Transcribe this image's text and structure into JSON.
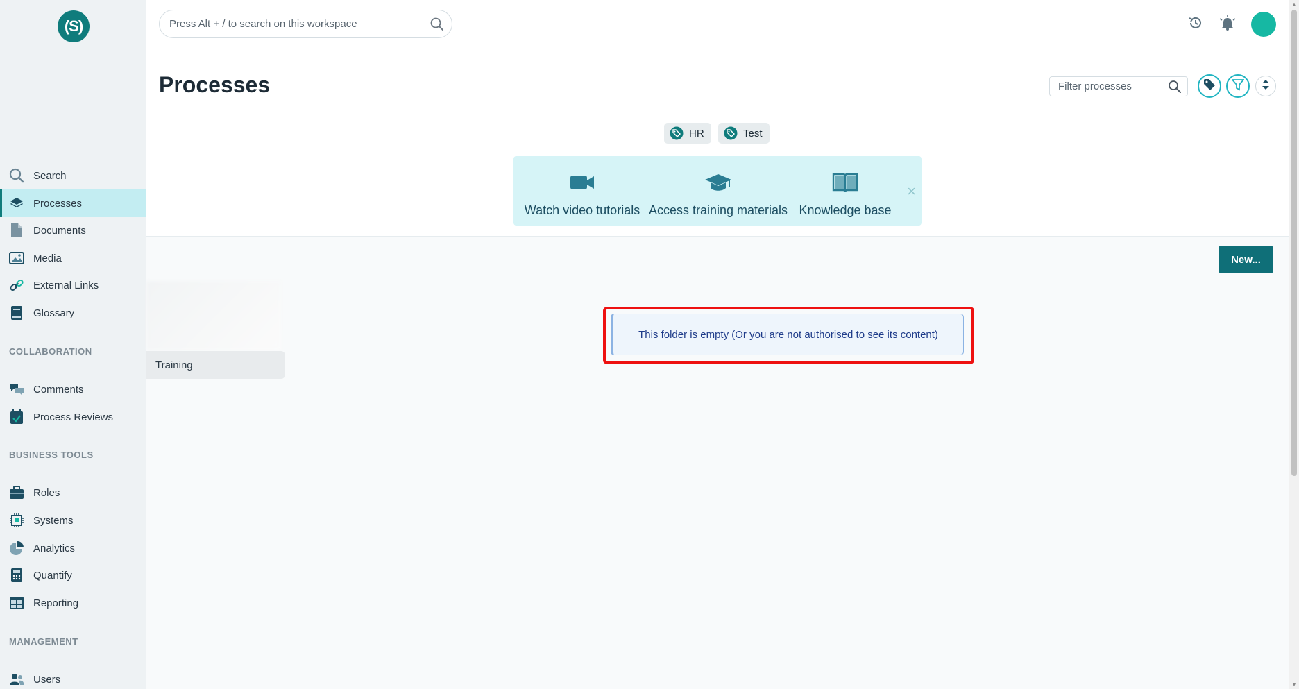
{
  "app": {
    "logo_text": "(S)"
  },
  "search": {
    "placeholder": "Press Alt + / to search on this workspace"
  },
  "sidebar": {
    "items": [
      {
        "label": "Search",
        "icon": "search-icon"
      },
      {
        "label": "Processes",
        "icon": "layers-icon",
        "active": true
      },
      {
        "label": "Documents",
        "icon": "document-icon"
      },
      {
        "label": "Media",
        "icon": "image-icon"
      },
      {
        "label": "External Links",
        "icon": "link-icon"
      },
      {
        "label": "Glossary",
        "icon": "book-icon"
      }
    ],
    "sections": {
      "collaboration": "COLLABORATION",
      "business_tools": "BUSINESS TOOLS",
      "management": "MANAGEMENT"
    },
    "collab_items": [
      {
        "label": "Comments",
        "icon": "comments-icon"
      },
      {
        "label": "Process Reviews",
        "icon": "calendar-check-icon"
      }
    ],
    "tools_items": [
      {
        "label": "Roles",
        "icon": "briefcase-icon"
      },
      {
        "label": "Systems",
        "icon": "chip-icon"
      },
      {
        "label": "Analytics",
        "icon": "pie-chart-icon"
      },
      {
        "label": "Quantify",
        "icon": "calculator-icon"
      },
      {
        "label": "Reporting",
        "icon": "table-icon"
      }
    ],
    "mgmt_items": [
      {
        "label": "Users",
        "icon": "users-icon"
      }
    ]
  },
  "header": {
    "title": "Processes",
    "filter_placeholder": "Filter processes"
  },
  "tags": [
    "HR",
    "Test"
  ],
  "help_panel": {
    "items": [
      {
        "label": "Watch video tutorials",
        "icon": "video-camera-icon"
      },
      {
        "label": "Access training materials",
        "icon": "graduation-cap-icon"
      },
      {
        "label": "Knowledge base",
        "icon": "open-book-icon"
      }
    ],
    "close": "×"
  },
  "actions": {
    "new_label": "New..."
  },
  "folders": {
    "training_label": "Training"
  },
  "empty_message": "This folder is empty (Or you are not authorised to see its content)",
  "colors": {
    "brand": "#0f7c7c",
    "active_nav_bg": "#c3edf2",
    "highlight": "#ee1111"
  }
}
